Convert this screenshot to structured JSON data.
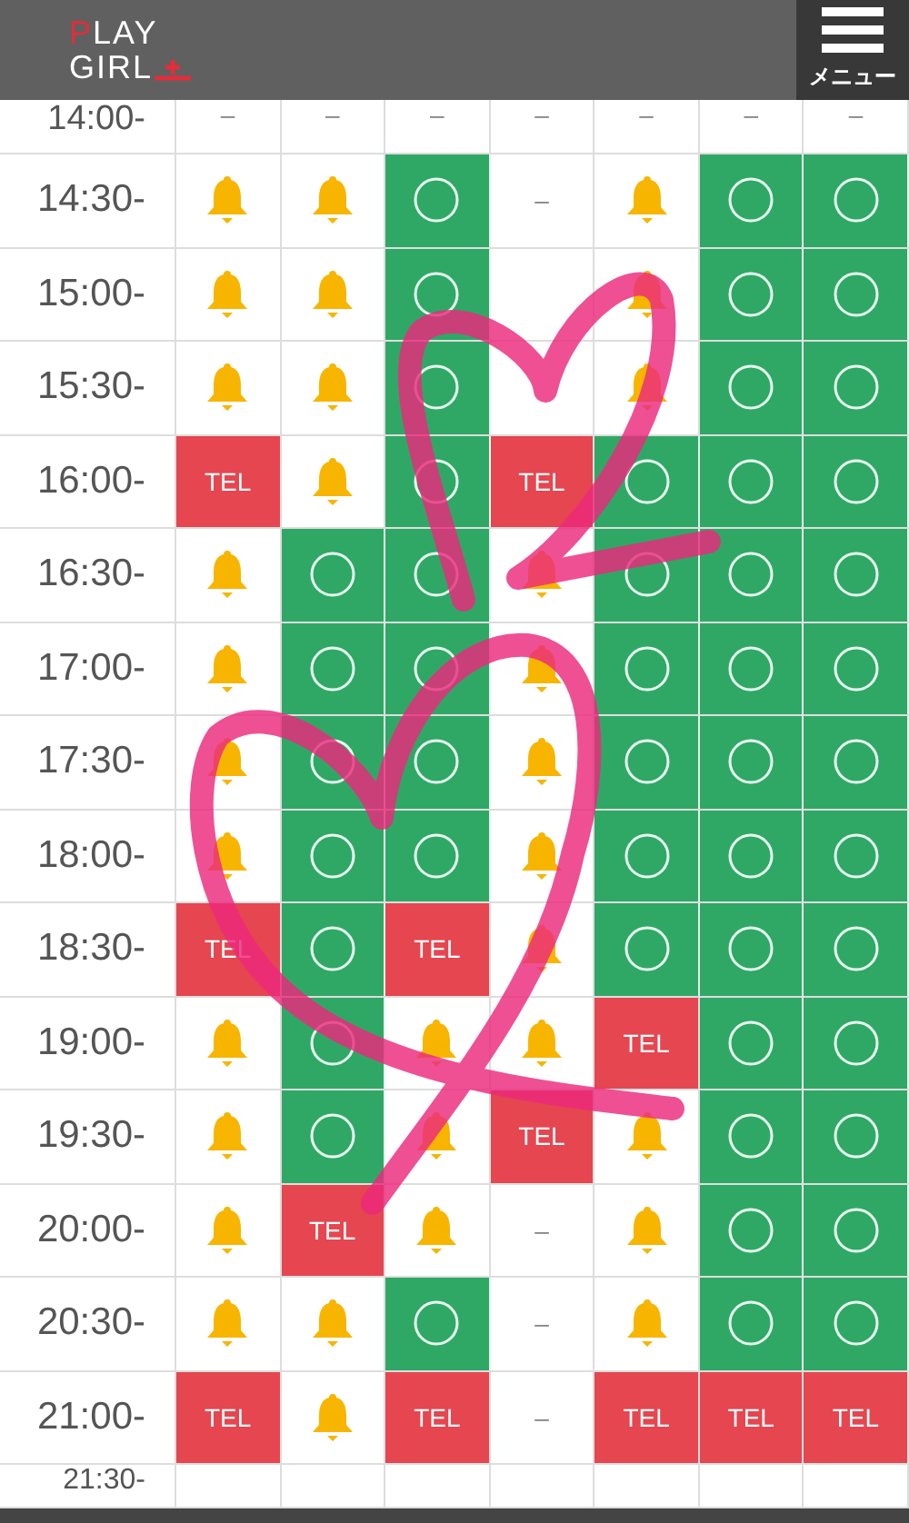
{
  "header": {
    "logo": {
      "line_1": "PLAY",
      "line_2": "GIRL"
    },
    "menu_label": "メニュー"
  },
  "rows": [
    {
      "time": "14:00-",
      "cells": [
        {
          "kind": "dash",
          "text": "–"
        },
        {
          "kind": "dash",
          "text": "–"
        },
        {
          "kind": "dash",
          "text": "–"
        },
        {
          "kind": "dash",
          "text": "–"
        },
        {
          "kind": "dash",
          "text": "–"
        },
        {
          "kind": "dash",
          "text": "–"
        },
        {
          "kind": "dash",
          "text": "–"
        }
      ]
    },
    {
      "time": "14:30-",
      "cells": [
        {
          "kind": "bell"
        },
        {
          "kind": "bell"
        },
        {
          "kind": "ok"
        },
        {
          "kind": "dash",
          "text": "–"
        },
        {
          "kind": "bell"
        },
        {
          "kind": "ok"
        },
        {
          "kind": "ok"
        }
      ]
    },
    {
      "time": "15:00-",
      "cells": [
        {
          "kind": "bell"
        },
        {
          "kind": "bell"
        },
        {
          "kind": "ok"
        },
        {
          "kind": "blank"
        },
        {
          "kind": "bell"
        },
        {
          "kind": "ok"
        },
        {
          "kind": "ok"
        }
      ]
    },
    {
      "time": "15:30-",
      "cells": [
        {
          "kind": "bell"
        },
        {
          "kind": "bell"
        },
        {
          "kind": "ok"
        },
        {
          "kind": "blank"
        },
        {
          "kind": "bell"
        },
        {
          "kind": "ok"
        },
        {
          "kind": "ok"
        }
      ]
    },
    {
      "time": "16:00-",
      "cells": [
        {
          "kind": "tel",
          "text": "TEL"
        },
        {
          "kind": "bell"
        },
        {
          "kind": "ok"
        },
        {
          "kind": "tel",
          "text": "TEL"
        },
        {
          "kind": "ok"
        },
        {
          "kind": "ok"
        },
        {
          "kind": "ok"
        }
      ]
    },
    {
      "time": "16:30-",
      "cells": [
        {
          "kind": "bell"
        },
        {
          "kind": "ok"
        },
        {
          "kind": "ok"
        },
        {
          "kind": "bell"
        },
        {
          "kind": "ok"
        },
        {
          "kind": "ok"
        },
        {
          "kind": "ok"
        }
      ]
    },
    {
      "time": "17:00-",
      "cells": [
        {
          "kind": "bell"
        },
        {
          "kind": "ok"
        },
        {
          "kind": "ok"
        },
        {
          "kind": "bell"
        },
        {
          "kind": "ok"
        },
        {
          "kind": "ok"
        },
        {
          "kind": "ok"
        }
      ]
    },
    {
      "time": "17:30-",
      "cells": [
        {
          "kind": "bell"
        },
        {
          "kind": "ok"
        },
        {
          "kind": "ok"
        },
        {
          "kind": "bell"
        },
        {
          "kind": "ok"
        },
        {
          "kind": "ok"
        },
        {
          "kind": "ok"
        }
      ]
    },
    {
      "time": "18:00-",
      "cells": [
        {
          "kind": "bell"
        },
        {
          "kind": "ok"
        },
        {
          "kind": "ok"
        },
        {
          "kind": "bell"
        },
        {
          "kind": "ok"
        },
        {
          "kind": "ok"
        },
        {
          "kind": "ok"
        }
      ]
    },
    {
      "time": "18:30-",
      "cells": [
        {
          "kind": "tel",
          "text": "TEL"
        },
        {
          "kind": "ok"
        },
        {
          "kind": "tel",
          "text": "TEL"
        },
        {
          "kind": "bell"
        },
        {
          "kind": "ok"
        },
        {
          "kind": "ok"
        },
        {
          "kind": "ok"
        }
      ]
    },
    {
      "time": "19:00-",
      "cells": [
        {
          "kind": "bell"
        },
        {
          "kind": "ok"
        },
        {
          "kind": "bell"
        },
        {
          "kind": "bell"
        },
        {
          "kind": "tel",
          "text": "TEL"
        },
        {
          "kind": "ok"
        },
        {
          "kind": "ok"
        }
      ]
    },
    {
      "time": "19:30-",
      "cells": [
        {
          "kind": "bell"
        },
        {
          "kind": "ok"
        },
        {
          "kind": "bell"
        },
        {
          "kind": "tel",
          "text": "TEL"
        },
        {
          "kind": "bell"
        },
        {
          "kind": "ok"
        },
        {
          "kind": "ok"
        }
      ]
    },
    {
      "time": "20:00-",
      "cells": [
        {
          "kind": "bell"
        },
        {
          "kind": "tel",
          "text": "TEL"
        },
        {
          "kind": "bell"
        },
        {
          "kind": "dash",
          "text": "–"
        },
        {
          "kind": "bell"
        },
        {
          "kind": "ok"
        },
        {
          "kind": "ok"
        }
      ]
    },
    {
      "time": "20:30-",
      "cells": [
        {
          "kind": "bell"
        },
        {
          "kind": "bell"
        },
        {
          "kind": "ok"
        },
        {
          "kind": "dash",
          "text": "–"
        },
        {
          "kind": "bell"
        },
        {
          "kind": "ok"
        },
        {
          "kind": "ok"
        }
      ]
    },
    {
      "time": "21:00-",
      "cells": [
        {
          "kind": "tel",
          "text": "TEL"
        },
        {
          "kind": "bell"
        },
        {
          "kind": "tel",
          "text": "TEL"
        },
        {
          "kind": "dash",
          "text": "–"
        },
        {
          "kind": "tel",
          "text": "TEL"
        },
        {
          "kind": "tel",
          "text": "TEL"
        },
        {
          "kind": "tel",
          "text": "TEL"
        }
      ]
    },
    {
      "time": "21:30-",
      "cells": [
        {
          "kind": "blank"
        },
        {
          "kind": "blank"
        },
        {
          "kind": "blank"
        },
        {
          "kind": "blank"
        },
        {
          "kind": "blank"
        },
        {
          "kind": "blank"
        },
        {
          "kind": "blank"
        }
      ]
    }
  ]
}
